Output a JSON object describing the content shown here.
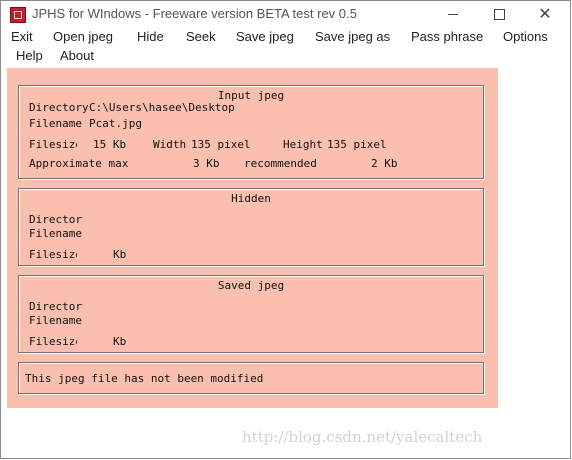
{
  "window": {
    "title": "JPHS for WIndows - Freeware version BETA test rev 0.5"
  },
  "menu": {
    "exit": "Exit",
    "open_jpeg": "Open jpeg",
    "hide": "Hide",
    "seek": "Seek",
    "save_jpeg": "Save jpeg",
    "save_jpeg_as": "Save jpeg as",
    "pass_phrase": "Pass phrase",
    "options": "Options",
    "help": "Help",
    "about": "About"
  },
  "input_jpeg": {
    "title": "Input jpeg",
    "directory_label": "Directory",
    "directory_value": "C:\\Users\\hasee\\Desktop",
    "filename_label": "Filename",
    "filename_value": "Pcat.jpg",
    "filesize_label": "Filesize",
    "filesize_value": "15 Kb",
    "width_label": "Width",
    "width_value": "135 pixel",
    "height_label": "Height",
    "height_value": "135 pixel",
    "approx_max_label": "Approximate max",
    "approx_max_value": "3 Kb",
    "recommended_label": "recommended",
    "recommended_value": "2 Kb"
  },
  "hidden": {
    "title": "Hidden",
    "directory_label": "Directory",
    "filename_label": "Filename",
    "filesize_label": "Filesize",
    "filesize_unit": "Kb"
  },
  "saved_jpeg": {
    "title": "Saved jpeg",
    "directory_label": "Directory",
    "filename_label": "Filename",
    "filesize_label": "Filesize",
    "filesize_unit": "Kb"
  },
  "status": {
    "message": "This jpeg file has not been modified"
  },
  "watermark": "http://blog.csdn.net/yalecaltech"
}
